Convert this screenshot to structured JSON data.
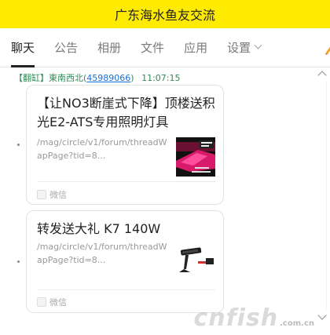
{
  "window": {
    "title": "广东海水鱼友交流"
  },
  "tabs": [
    {
      "label": "聊天"
    },
    {
      "label": "公告"
    },
    {
      "label": "相册"
    },
    {
      "label": "文件"
    },
    {
      "label": "应用"
    },
    {
      "label": "设置"
    }
  ],
  "message": {
    "sender_tag": "【翻缸】",
    "sender_name": "東南西北",
    "sender_id_open": "(",
    "sender_id": "45989066",
    "sender_id_close": ")",
    "time": "11:07:15"
  },
  "cards": [
    {
      "title": "【让NO3断崖式下降】顶楼送积光E2-ATS专用照明灯具",
      "desc": "/mag/circle/v1/forum/threadWapPage?tid=8...",
      "source": "微信"
    },
    {
      "title": "转发送大礼 K7 140W",
      "desc": "/mag/circle/v1/forum/threadWapPage?tid=8...",
      "source": "微信"
    }
  ],
  "watermark": {
    "brand": "cnfish",
    "suffix": ".com.cn"
  },
  "icons": {
    "tab_dropdown": "chevron-down-icon",
    "edit": "pencil-icon",
    "scroll_up": "chevron-up-icon",
    "scroll_down": "chevron-down-icon",
    "source_app": "app-icon"
  },
  "colors": {
    "titlebar": "#ffeb00",
    "sender_meta": "#2e8b57",
    "sender_id_link": "#1a6fd6"
  }
}
